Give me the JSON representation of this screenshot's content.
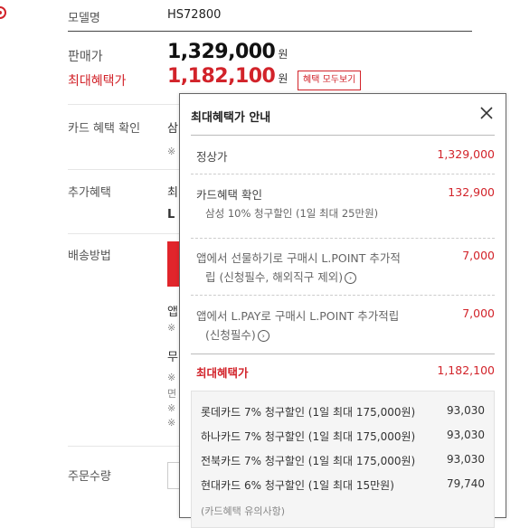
{
  "product": {
    "model_label": "모델명",
    "model_value": "HS72800",
    "sale_label": "판매가",
    "sale_price": "1,329,000",
    "max_label": "최대혜택가",
    "max_price": "1,182,100",
    "won": "원",
    "benefit_button": "혜택 모두보기",
    "card_check_label": "카드 혜택 확인",
    "card_check_partial": "삼",
    "card_note_partial": "※",
    "extra_label": "추가혜택",
    "extra_partial_1": "최",
    "extra_partial_2": "L",
    "delivery_label": "배송방법",
    "delivery_partial_1": "앱",
    "delivery_partial_2": "※",
    "delivery_partial_3": "무",
    "delivery_partial_4": "※",
    "delivery_partial_5": "면",
    "delivery_partial_6": "※",
    "delivery_partial_7": "※",
    "qty_label": "주문수량"
  },
  "popup": {
    "title": "최대혜택가 안내",
    "regular_label": "정상가",
    "regular_value": "1,329,000",
    "card_label": "카드혜택 확인",
    "card_sub": "삼성 10% 청구할인 (1일 최대 25만원)",
    "card_value": "132,900",
    "lpoint_gift_label_1": "앱에서 선물하기로 구매시 L.POINT 추가적",
    "lpoint_gift_label_2": "립 (신청필수, 해외직구 제외)",
    "lpoint_gift_value": "7,000",
    "lpay_label_1": "앱에서 L.PAY로 구매시 L.POINT 추가적립",
    "lpay_label_2": "(신청필수)",
    "lpay_value": "7,000",
    "max_label": "최대혜택가",
    "max_value": "1,182,100",
    "card_discounts": [
      {
        "label": "롯데카드 7% 청구할인  (1일 최대 175,000원)",
        "value": "93,030"
      },
      {
        "label": "하나카드 7% 청구할인  (1일 최대 175,000원)",
        "value": "93,030"
      },
      {
        "label": "전북카드 7% 청구할인  (1일 최대 175,000원)",
        "value": "93,030"
      },
      {
        "label": "현대카드 6% 청구할인  (1일 최대 15만원)",
        "value": "79,740"
      }
    ],
    "cut_text": "(카드혜택 유의사항)"
  },
  "colors": {
    "accent": "#d2232a"
  },
  "icons": {
    "info": "info-circle-icon",
    "close": "close-icon"
  }
}
